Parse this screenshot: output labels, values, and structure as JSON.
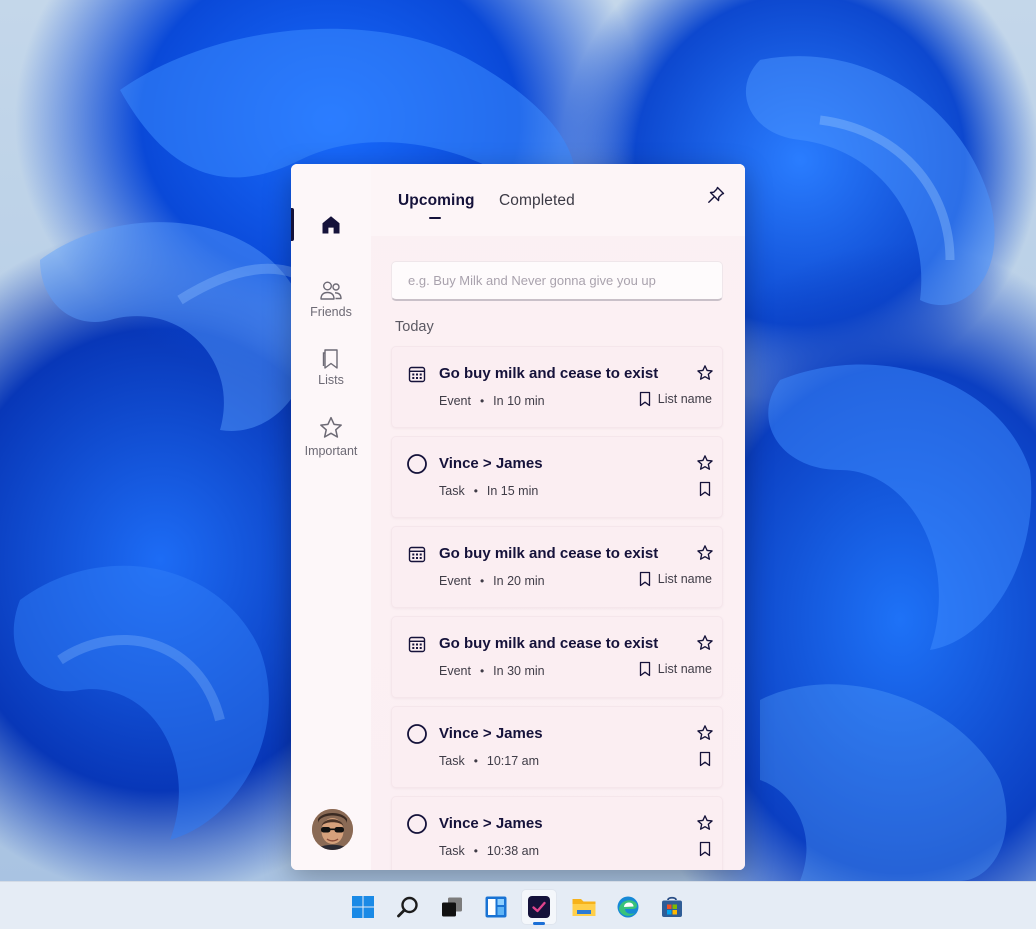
{
  "sidebar": {
    "items": [
      {
        "name": "home",
        "label": "",
        "icon": "home-icon"
      },
      {
        "name": "friends",
        "label": "Friends",
        "icon": "people-icon"
      },
      {
        "name": "lists",
        "label": "Lists",
        "icon": "bookmark-icon"
      },
      {
        "name": "important",
        "label": "Important",
        "icon": "star-icon"
      }
    ]
  },
  "header": {
    "tabs": [
      {
        "label": "Upcoming",
        "active": true
      },
      {
        "label": "Completed",
        "active": false
      }
    ]
  },
  "search": {
    "placeholder": "e.g. Buy Milk and Never gonna give you up",
    "value": ""
  },
  "section": {
    "label": "Today"
  },
  "items": [
    {
      "kind": "event",
      "title": "Go buy milk and cease to exist",
      "type_label": "Event",
      "time": "In 10 min",
      "list": "List name"
    },
    {
      "kind": "task",
      "title": "Vince > James",
      "type_label": "Task",
      "time": "In 15 min",
      "list": ""
    },
    {
      "kind": "event",
      "title": "Go buy milk and cease to exist",
      "type_label": "Event",
      "time": "In 20 min",
      "list": "List name"
    },
    {
      "kind": "event",
      "title": "Go buy milk and cease to exist",
      "type_label": "Event",
      "time": "In 30 min",
      "list": "List name"
    },
    {
      "kind": "task",
      "title": "Vince > James",
      "type_label": "Task",
      "time": "10:17 am",
      "list": ""
    },
    {
      "kind": "task",
      "title": "Vince > James",
      "type_label": "Task",
      "time": "10:38 am",
      "list": ""
    }
  ],
  "colors": {
    "accent_dark": "#15123a",
    "card_bg": "#fbeef2",
    "taskbar_bg": "#e5ecf5"
  },
  "taskbar": {
    "icons": [
      "windows-start-icon",
      "search-icon",
      "task-view-icon",
      "widgets-icon",
      "todo-app-icon",
      "file-explorer-icon",
      "edge-browser-icon",
      "store-icon"
    ],
    "active": "todo-app-icon"
  }
}
